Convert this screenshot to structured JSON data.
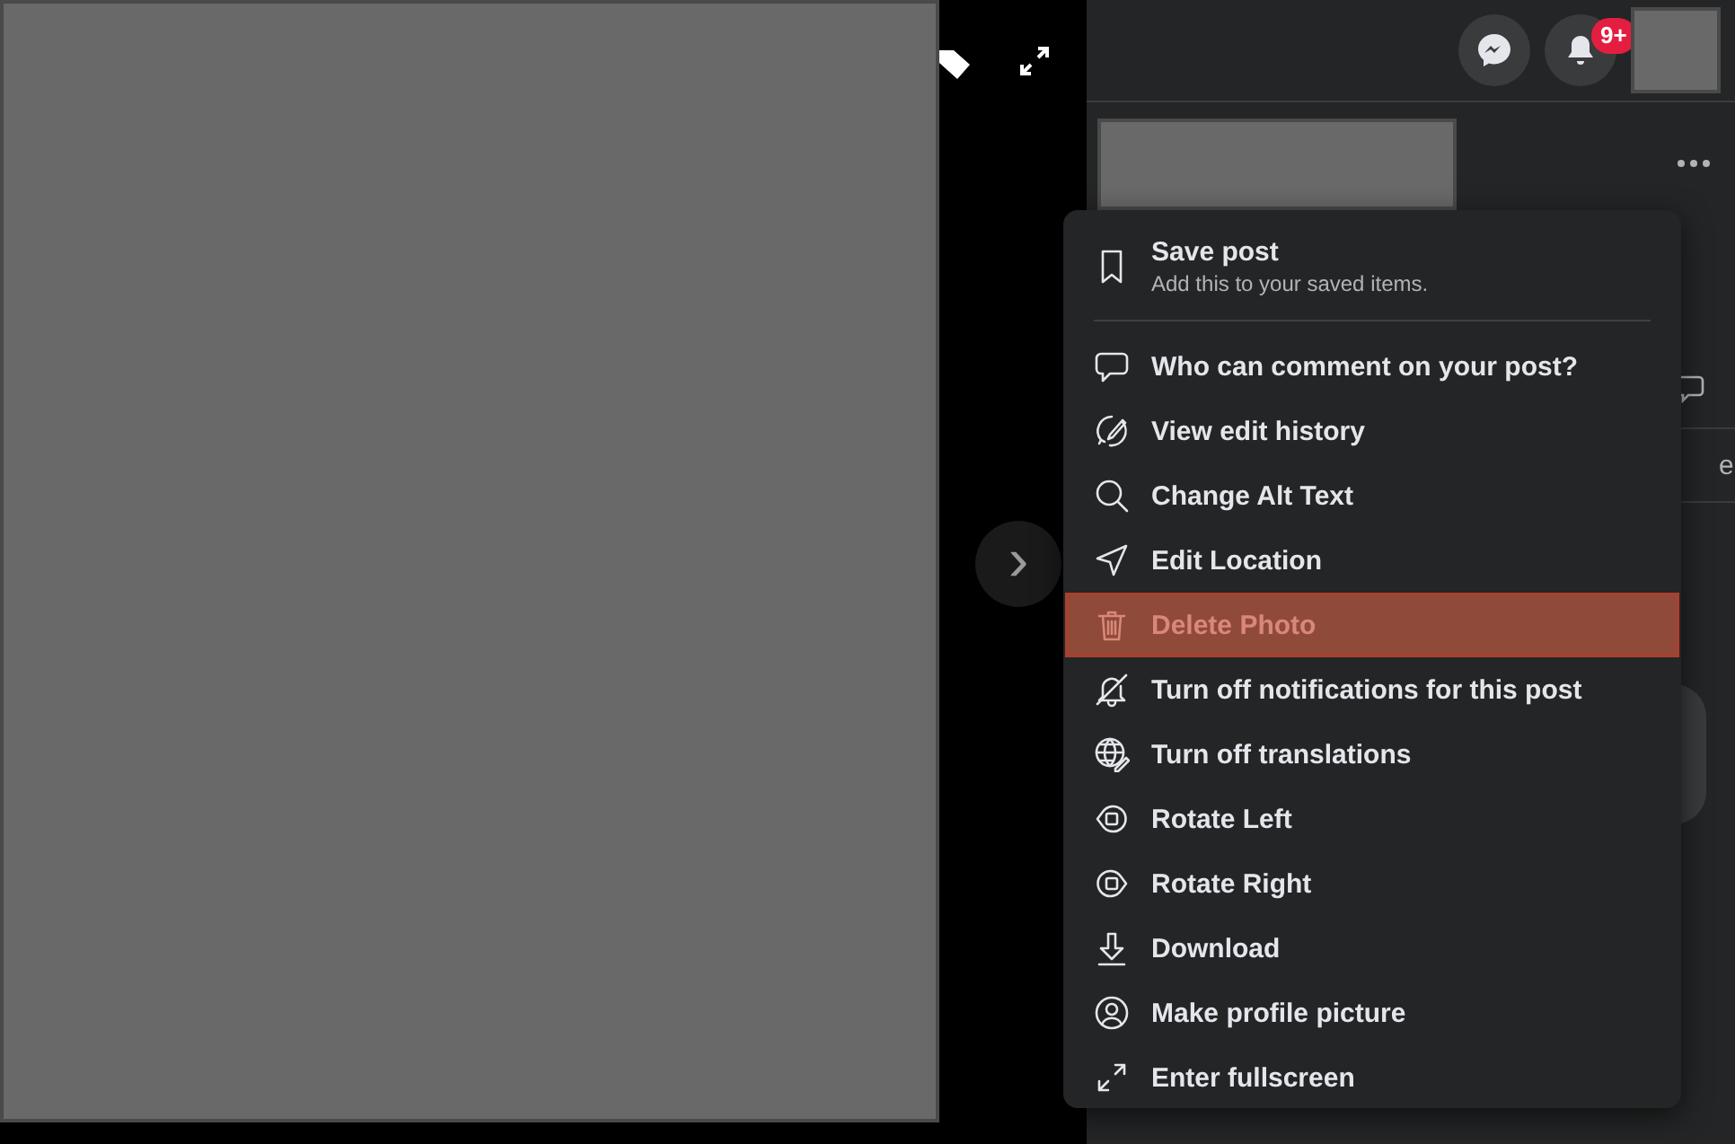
{
  "viewer": {
    "next_button": "›"
  },
  "header": {
    "notification_badge": "9+"
  },
  "behind_menu_fragment": "e",
  "menu": {
    "items": [
      {
        "label": "Save post",
        "description": "Add this to your saved items.",
        "highlighted": false
      },
      {
        "label": "Who can comment on your post?",
        "highlighted": false
      },
      {
        "label": "View edit history",
        "highlighted": false
      },
      {
        "label": "Change Alt Text",
        "highlighted": false
      },
      {
        "label": "Edit Location",
        "highlighted": false
      },
      {
        "label": "Delete Photo",
        "highlighted": true
      },
      {
        "label": "Turn off notifications for this post",
        "highlighted": false
      },
      {
        "label": "Turn off translations",
        "highlighted": false
      },
      {
        "label": "Rotate Left",
        "highlighted": false
      },
      {
        "label": "Rotate Right",
        "highlighted": false
      },
      {
        "label": "Download",
        "highlighted": false
      },
      {
        "label": "Make profile picture",
        "highlighted": false
      },
      {
        "label": "Enter fullscreen",
        "highlighted": false
      }
    ]
  }
}
